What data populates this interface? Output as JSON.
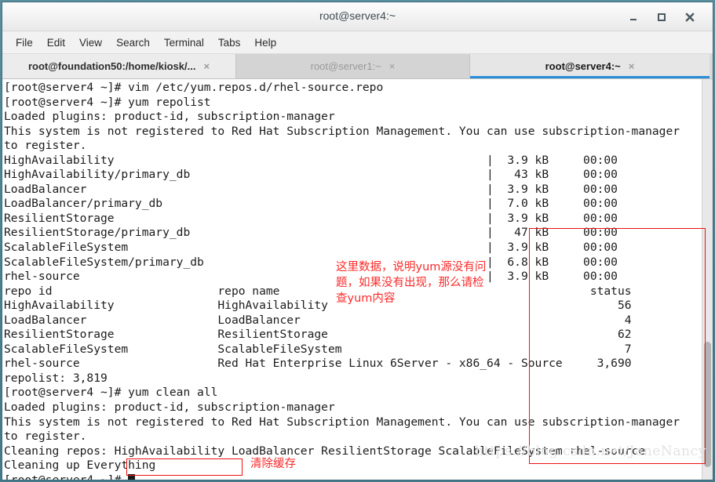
{
  "window": {
    "title": "root@server4:~",
    "buttons": {
      "minimize": "minimize-button",
      "maximize": "maximize-button",
      "close": "close-button"
    }
  },
  "menubar": {
    "items": [
      {
        "label": "File"
      },
      {
        "label": "Edit"
      },
      {
        "label": "View"
      },
      {
        "label": "Search"
      },
      {
        "label": "Terminal"
      },
      {
        "label": "Tabs"
      },
      {
        "label": "Help"
      }
    ]
  },
  "tabs": [
    {
      "label": "root@foundation50:/home/kiosk/...",
      "close": "×",
      "state": "inactive"
    },
    {
      "label": "root@server1:~",
      "close": "×",
      "state": "inactive-dim"
    },
    {
      "label": "root@server4:~",
      "close": "×",
      "state": "active"
    }
  ],
  "terminal": {
    "lines": [
      "[root@server4 ~]# vim /etc/yum.repos.d/rhel-source.repo",
      "[root@server4 ~]# yum repolist",
      "Loaded plugins: product-id, subscription-manager",
      "This system is not registered to Red Hat Subscription Management. You can use subscription-manager",
      "to register.",
      "HighAvailability                                                      |  3.9 kB     00:00",
      "HighAvailability/primary_db                                           |   43 kB     00:00",
      "LoadBalancer                                                          |  3.9 kB     00:00",
      "LoadBalancer/primary_db                                               |  7.0 kB     00:00",
      "ResilientStorage                                                      |  3.9 kB     00:00",
      "ResilientStorage/primary_db                                           |   47 kB     00:00",
      "ScalableFileSystem                                                    |  3.9 kB     00:00",
      "ScalableFileSystem/primary_db                                         |  6.8 kB     00:00",
      "rhel-source                                                           |  3.9 kB     00:00",
      "repo id                        repo name                                             status",
      "HighAvailability               HighAvailability                                          56",
      "LoadBalancer                   LoadBalancer                                               4",
      "ResilientStorage               ResilientStorage                                          62",
      "ScalableFileSystem             ScalableFileSystem                                         7",
      "rhel-source                    Red Hat Enterprise Linux 6Server - x86_64 - Source     3,690",
      "repolist: 3,819",
      "[root@server4 ~]# yum clean all",
      "Loaded plugins: product-id, subscription-manager",
      "This system is not registered to Red Hat Subscription Management. You can use subscription-manager",
      "to register.",
      "Cleaning repos: HighAvailability LoadBalancer ResilientStorage ScalableFileSystem rhel-source",
      "Cleaning up Everything"
    ],
    "prompt": "[root@server4 ~]# ",
    "cursor": "block-cursor"
  },
  "annotations": {
    "repodata_note": "这里数据，说明yum源没有问\n题，如果没有出现，那么请检\n查yum内容",
    "clean_note": "清除缓存",
    "box_repodata": "highlight-repo-data",
    "box_command": "highlight-yum-clean-all"
  },
  "watermark": "https://blog.csdn.net/JaneNancy",
  "colors": {
    "annotation_red": "#fb2a2a",
    "box_red": "#ee1111",
    "active_tab_underline": "#2a8fd8",
    "terminal_bg": "#ffffff",
    "terminal_fg": "#1c1c1c",
    "desktop": "#4d8392"
  }
}
